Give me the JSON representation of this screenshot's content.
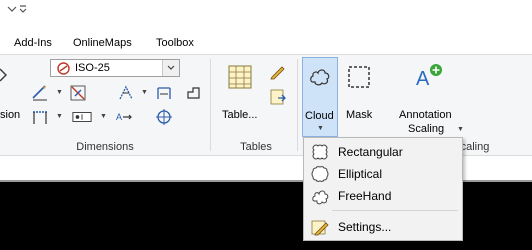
{
  "tabs": [
    "Add-Ins",
    "OnlineMaps",
    "Toolbox"
  ],
  "dimensions": {
    "style_value": "ISO-25",
    "partial_label": "sion",
    "group_label": "Dimensions"
  },
  "tables": {
    "button_label": "Table...",
    "group_label": "Tables"
  },
  "cloud": {
    "label": "Cloud"
  },
  "mask": {
    "label": "Mask"
  },
  "annotation": {
    "line1": "Annotation",
    "line2": "Scaling",
    "group_label_partial": "caling"
  },
  "menu": {
    "items": [
      "Rectangular",
      "Elliptical",
      "FreeHand"
    ],
    "settings": "Settings..."
  },
  "colors": {
    "ribbon_bg": "#f5f6f7",
    "pressed_bg": "#cfe3f8",
    "menu_bg": "#f2f2f2"
  }
}
